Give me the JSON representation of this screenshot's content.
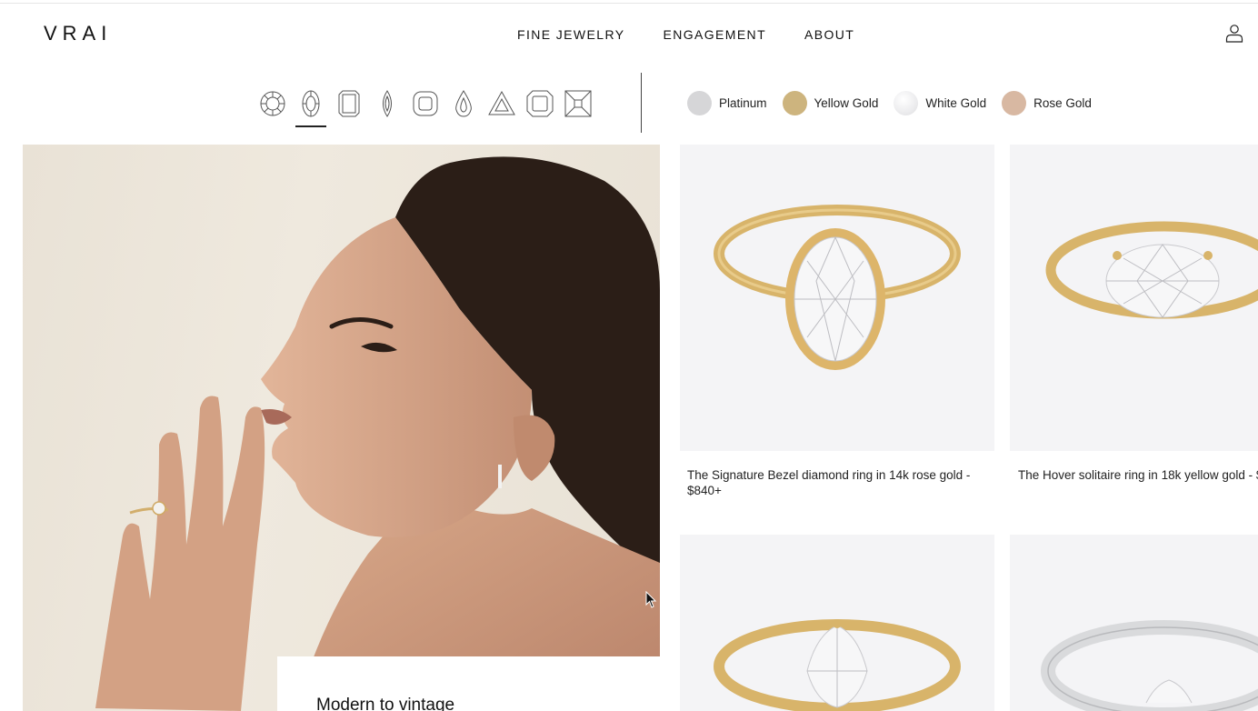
{
  "header": {
    "logo": "VRAI",
    "nav": [
      "FINE JEWELRY",
      "ENGAGEMENT",
      "ABOUT"
    ]
  },
  "filters": {
    "shapes": [
      {
        "name": "round",
        "icon": "round-shape-icon",
        "active": false
      },
      {
        "name": "oval",
        "icon": "oval-shape-icon",
        "active": true
      },
      {
        "name": "emerald",
        "icon": "emerald-shape-icon",
        "active": false
      },
      {
        "name": "marquise",
        "icon": "marquise-shape-icon",
        "active": false
      },
      {
        "name": "cushion",
        "icon": "cushion-shape-icon",
        "active": false
      },
      {
        "name": "pear",
        "icon": "pear-shape-icon",
        "active": false
      },
      {
        "name": "trillion",
        "icon": "trillion-shape-icon",
        "active": false
      },
      {
        "name": "radiant",
        "icon": "radiant-shape-icon",
        "active": false
      },
      {
        "name": "princess",
        "icon": "princess-shape-icon",
        "active": false
      }
    ],
    "metals": [
      {
        "label": "Platinum",
        "color": "#d6d6d8"
      },
      {
        "label": "Yellow Gold",
        "color": "#cdb47e"
      },
      {
        "label": "White Gold",
        "color": "#ececee"
      },
      {
        "label": "Rose Gold",
        "color": "#d8b8a2"
      }
    ]
  },
  "hero": {
    "caption": "Modern to vintage"
  },
  "products": [
    {
      "title": "The Signature Bezel diamond ring in 14k rose gold - $840+"
    },
    {
      "title": "The Hover solitaire ring in 18k yellow gold - $"
    },
    {
      "title": ""
    },
    {
      "title": ""
    }
  ],
  "colors": {
    "gold": "#d8b46a",
    "silver": "#d9dadc",
    "card_bg": "#f4f4f6"
  }
}
